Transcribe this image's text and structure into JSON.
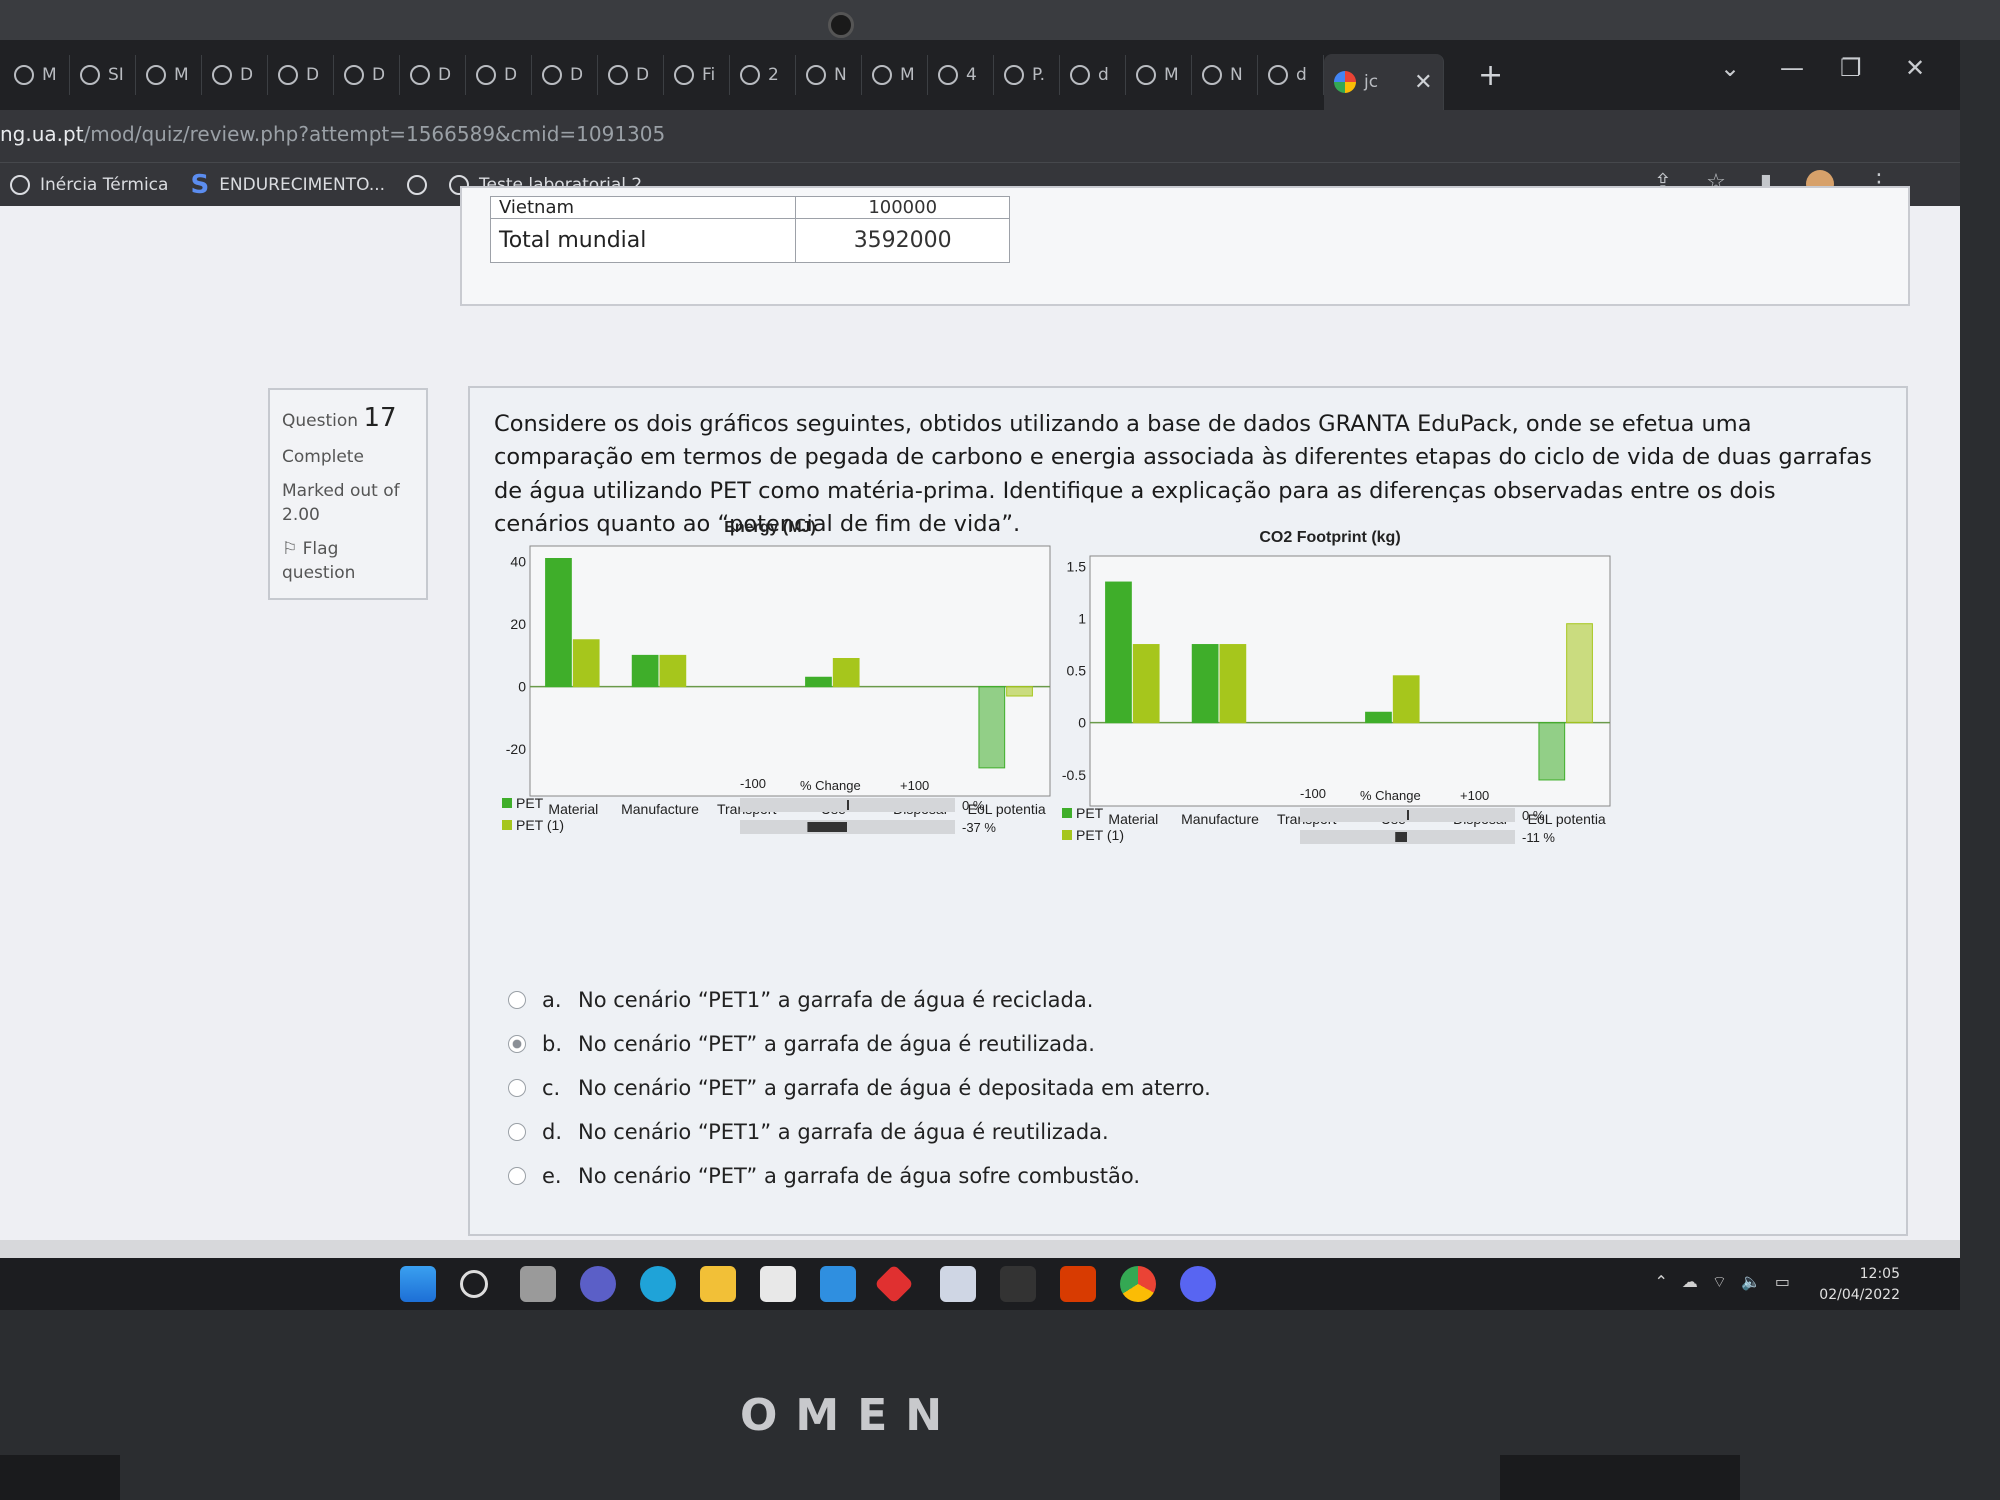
{
  "browser": {
    "tabs": [
      "M",
      "SI",
      "M",
      "D",
      "D",
      "D",
      "D",
      "D",
      "D",
      "D",
      "Fi",
      "2",
      "N",
      "M",
      "4",
      "P.",
      "d",
      "M",
      "N",
      "d"
    ],
    "active_tab": "jc",
    "url_host": "ng.ua.pt",
    "url_path": "/mod/quiz/review.php?attempt=1566589&cmid=1091305",
    "bookmarks": [
      "Inércia Térmica",
      "ENDURECIMENTO...",
      "",
      "Teste laboratorial 2..."
    ]
  },
  "prev_table": {
    "row_partial": "Vietnam",
    "row_partial_value": "100000",
    "total_label": "Total mundial",
    "total_value": "3592000"
  },
  "question": {
    "label": "Question",
    "number": "17",
    "status": "Complete",
    "marked": "Marked out of 2.00",
    "flag": "Flag question",
    "text": "Considere os dois gráficos seguintes, obtidos utilizando a base de dados GRANTA EduPack, onde se efetua uma comparação em termos de pegada de carbono e energia associada às diferentes etapas do ciclo de vida de duas garrafas de água utilizando PET como matéria-prima. Identifique a explicação para as diferenças observadas entre os dois cenários quanto ao “potencial de fim de vida”.",
    "options": [
      {
        "letter": "a.",
        "text": "No cenário “PET1” a garrafa de água é reciclada.",
        "selected": false
      },
      {
        "letter": "b.",
        "text": "No cenário “PET” a garrafa de água é reutilizada.",
        "selected": true
      },
      {
        "letter": "c.",
        "text": "No cenário “PET” a garrafa de água é depositada em aterro.",
        "selected": false
      },
      {
        "letter": "d.",
        "text": "No cenário “PET1” a garrafa de água é reutilizada.",
        "selected": false
      },
      {
        "letter": "e.",
        "text": "No cenário “PET” a garrafa de água sofre combustão.",
        "selected": false
      }
    ]
  },
  "colors": {
    "pet": "#3fae2a",
    "pet1": "#a6c61c"
  },
  "chart_data": [
    {
      "type": "bar",
      "title": "Energy (MJ)",
      "categories": [
        "Material",
        "Manufacture",
        "Transport",
        "Use",
        "Disposal",
        "EoL potentia"
      ],
      "series": [
        {
          "name": "PET",
          "values": [
            41,
            10,
            0,
            3,
            0,
            -26
          ]
        },
        {
          "name": "PET (1)",
          "values": [
            15,
            10,
            0,
            9,
            0,
            -3
          ]
        }
      ],
      "ylim": [
        -35,
        45
      ],
      "yticks": [
        40,
        20,
        0,
        -20
      ],
      "change": {
        "header": "% Change",
        "min": "-100",
        "max": "+100",
        "values": [
          "0 %",
          "-37 %"
        ]
      }
    },
    {
      "type": "bar",
      "title": "CO2 Footprint (kg)",
      "categories": [
        "Material",
        "Manufacture",
        "Transport",
        "Use",
        "Disposal",
        "EoL potentia"
      ],
      "series": [
        {
          "name": "PET",
          "values": [
            1.35,
            0.75,
            0,
            0.1,
            0,
            -0.55
          ]
        },
        {
          "name": "PET (1)",
          "values": [
            0.75,
            0.75,
            0,
            0.45,
            0,
            0.95
          ]
        }
      ],
      "ylim": [
        -0.8,
        1.6
      ],
      "yticks": [
        1.5,
        1,
        0.5,
        0,
        -0.5
      ],
      "ytick_labels": [
        "1.5",
        "1",
        "0.5",
        "0",
        "-0.5"
      ],
      "change": {
        "header": "% Change",
        "min": "-100",
        "max": "+100",
        "values": [
          "0 %",
          "-11 %"
        ]
      }
    }
  ],
  "taskbar": {
    "time": "12:05",
    "date": "02/04/2022"
  },
  "brand": "OMEN"
}
